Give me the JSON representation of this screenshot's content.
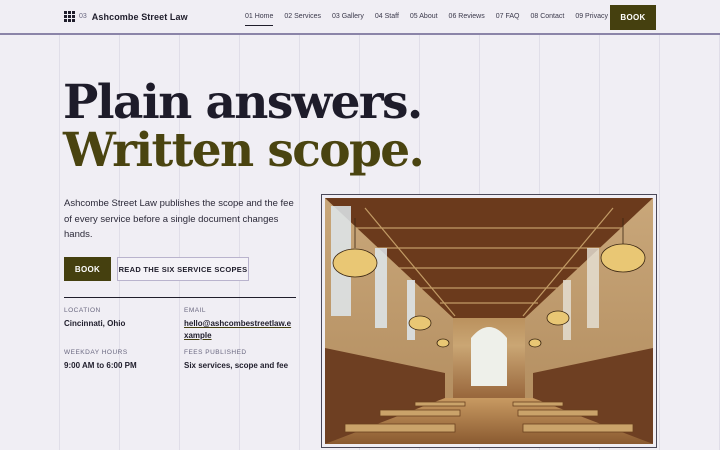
{
  "brand": {
    "number": "03",
    "name": "Ashcombe Street Law"
  },
  "nav": {
    "items": [
      {
        "label": "01 Home",
        "active": true
      },
      {
        "label": "02 Services",
        "active": false
      },
      {
        "label": "03 Gallery",
        "active": false
      },
      {
        "label": "04 Staff",
        "active": false
      },
      {
        "label": "05 About",
        "active": false
      },
      {
        "label": "06 Reviews",
        "active": false
      },
      {
        "label": "07 FAQ",
        "active": false
      },
      {
        "label": "08 Contact",
        "active": false
      },
      {
        "label": "09 Privacy",
        "active": false
      }
    ],
    "book_label": "BOOK"
  },
  "hero": {
    "line1": "Plain answers.",
    "line2": "Written scope.",
    "description": "Ashcombe Street Law publishes the scope and the fee of every service before a single document changes hands.",
    "book_button": "BOOK",
    "scopes_button": "READ THE SIX SERVICE SCOPES"
  },
  "info": {
    "location_label": "LOCATION",
    "location_value": "Cincinnati, Ohio",
    "email_label": "EMAIL",
    "email_value": "hello@ashcombestreetlaw.example",
    "hours_label": "WEEKDAY HOURS",
    "hours_value": "9:00 AM to 6:00 PM",
    "fees_label": "FEES PUBLISHED",
    "fees_value": "Six services, scope and fee"
  },
  "colors": {
    "background": "#f0eef4",
    "accent": "#45400f",
    "ink": "#1f1d2b"
  },
  "icons": {
    "brand": "grid-icon"
  }
}
